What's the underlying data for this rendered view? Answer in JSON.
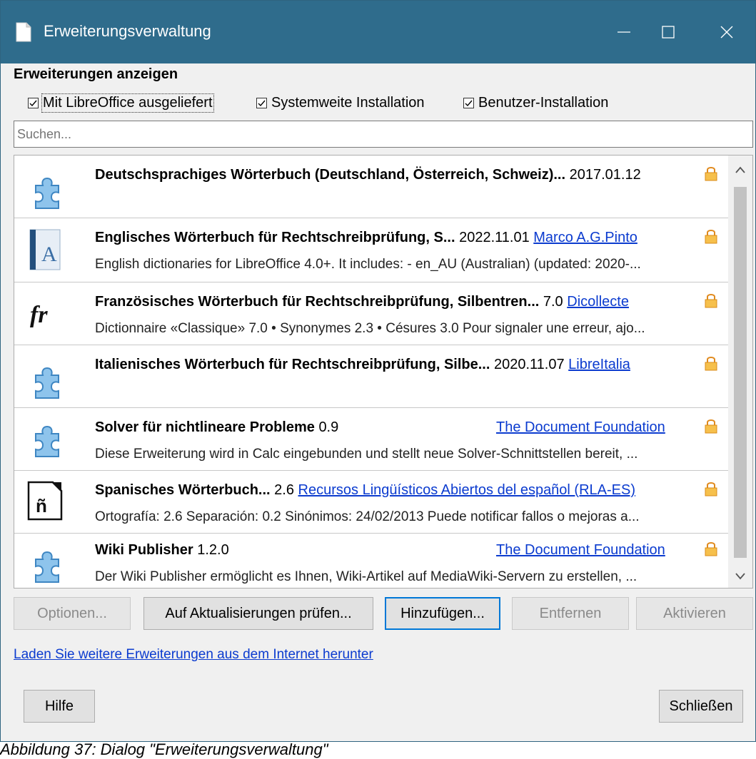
{
  "window": {
    "title": "Erweiterungsverwaltung",
    "titlebar_color": "#2f6c8c"
  },
  "filter": {
    "heading": "Erweiterungen anzeigen",
    "checkboxes": [
      {
        "label": "Mit LibreOffice ausgeliefert",
        "checked": true
      },
      {
        "label": "Systemweite Installation",
        "checked": true
      },
      {
        "label": "Benutzer-Installation",
        "checked": true
      }
    ]
  },
  "search": {
    "placeholder": "Suchen..."
  },
  "extensions": [
    {
      "name": "Deutschsprachiges Wörterbuch (Deutschland, Österreich, Schweiz)...",
      "version": "2017.01.12",
      "publisher": "",
      "description": "",
      "icon": "puzzle-icon",
      "locked": true
    },
    {
      "name": "Englisches Wörterbuch für Rechtschreibprüfung, S...",
      "version": "2022.11.01",
      "publisher": "Marco A.G.Pinto",
      "description": "English dictionaries for LibreOffice 4.0+.  It includes: - en_AU (Australian) (updated: 2020-...",
      "icon": "dictionary-a-icon",
      "locked": true
    },
    {
      "name": "Französisches Wörterbuch für Rechtschreibprüfung, Silbentren...",
      "version": "7.0",
      "publisher": "Dicollecte",
      "description": "Dictionnaire «Classique» 7.0 • Synonymes 2.3 • Césures 3.0  Pour signaler une erreur, ajo...",
      "icon": "fr-icon",
      "locked": true
    },
    {
      "name": "Italienisches Wörterbuch für Rechtschreibprüfung, Silbe...",
      "version": "2020.11.07",
      "publisher": "LibreItalia",
      "description": "",
      "icon": "puzzle-icon",
      "locked": true
    },
    {
      "name": "Solver für nichtlineare Probleme",
      "version": "0.9",
      "publisher": "The Document Foundation",
      "description": "Diese Erweiterung wird in Calc eingebunden und stellt neue Solver-Schnittstellen bereit, ...",
      "icon": "puzzle-icon",
      "locked": true
    },
    {
      "name": "Spanisches Wörterbuch...",
      "version": "2.6",
      "publisher": "Recursos Lingüísticos Abiertos del español (RLA-ES)",
      "description": "Ortografía: 2.6 Separación: 0.2 Sinónimos: 24/02/2013  Puede notificar fallos o mejoras a...",
      "icon": "n-tilde-icon",
      "locked": true
    },
    {
      "name": "Wiki Publisher",
      "version": "1.2.0",
      "publisher": "The Document Foundation",
      "description": "Der Wiki Publisher ermöglicht es Ihnen, Wiki-Artikel auf MediaWiki-Servern zu erstellen, ...",
      "icon": "puzzle-icon",
      "locked": true
    }
  ],
  "buttons": {
    "options": "Optionen...",
    "check_updates": "Auf Aktualisierungen prüfen...",
    "add": "Hinzufügen...",
    "remove": "Entfernen",
    "activate": "Aktivieren",
    "help": "Hilfe",
    "close": "Schließen"
  },
  "more_link": "Laden Sie weitere Erweiterungen aus dem Internet herunter",
  "caption": "Abbildung 37: Dialog \"Erweiterungsverwaltung\""
}
